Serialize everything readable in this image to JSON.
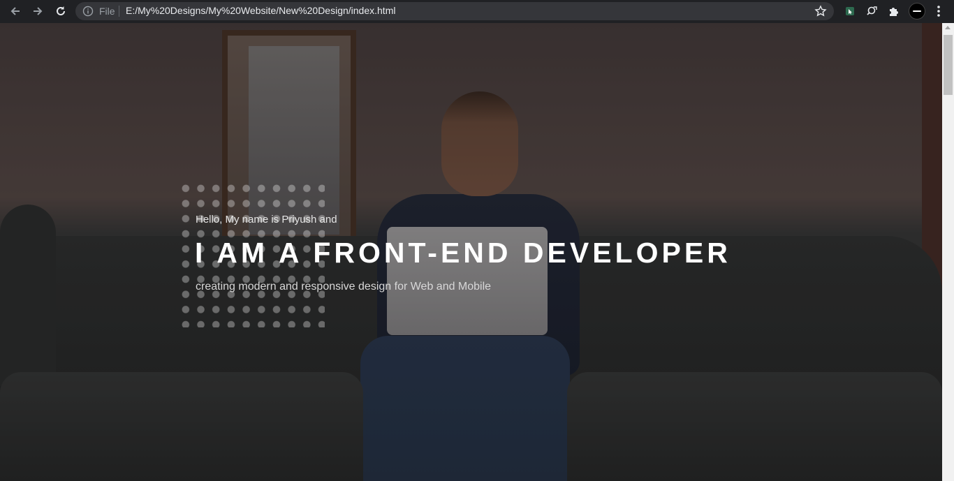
{
  "browser": {
    "file_label": "File",
    "url": "E:/My%20Designs/My%20Website/New%20Design/index.html",
    "icons": [
      "back-arrow-icon",
      "forward-arrow-icon",
      "reload-icon",
      "info-icon",
      "star-icon",
      "extension-icon",
      "search-extension-icon",
      "puzzle-icon",
      "profile-avatar",
      "kebab-menu-icon"
    ]
  },
  "hero": {
    "greeting": "Hello, My name is Priyush and",
    "headline": "I AM A FRONT-END DEVELOPER",
    "tagline": "creating modern and responsive design for Web and Mobile"
  },
  "colors": {
    "chrome_bg": "#202124",
    "omnibox_bg": "#35363a",
    "headline": "#ffffff"
  }
}
